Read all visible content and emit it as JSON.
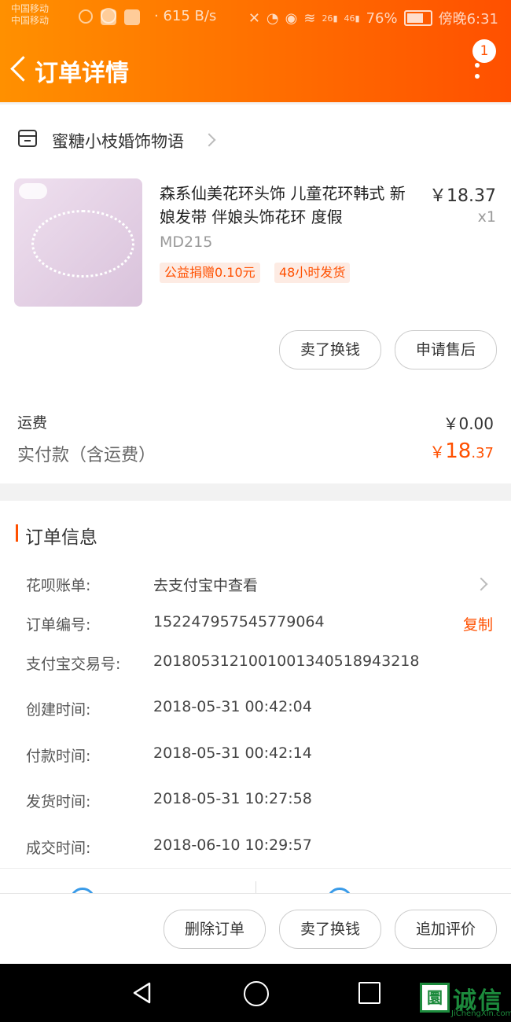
{
  "status_bar": {
    "carrier1": "中国移动",
    "carrier2": "中国移动",
    "net_speed": "· 615 B/s",
    "signal1": "26",
    "signal2": "46",
    "battery": "76%",
    "time": "傍晚6:31"
  },
  "header": {
    "title": "订单详情",
    "badge_count": "1"
  },
  "order_card": {
    "shop_name": "蜜糖小枝婚饰物语",
    "product": {
      "name": "森系仙美花环头饰 儿童花环韩式 新娘发带 伴娘头饰花环 度假",
      "sku": "MD215",
      "price": "￥18.37",
      "quantity": "x1",
      "tags": [
        "公益捐赠0.10元",
        "48小时发货"
      ]
    },
    "item_buttons": [
      "卖了换钱",
      "申请售后"
    ],
    "shipping_label": "运费",
    "shipping_value": "￥0.00",
    "paid_label": "实付款（含运费）",
    "paid_currency": "￥",
    "paid_integer": "18",
    "paid_decimal": ".37"
  },
  "order_info": {
    "title": "订单信息",
    "rows": [
      {
        "label": "花呗账单:",
        "value": "去支付宝中查看"
      },
      {
        "label": "订单编号:",
        "value": "152247957545779064",
        "action": "复制"
      },
      {
        "label": "支付宝交易号:",
        "value": "2018053121001001340518943218"
      },
      {
        "label": "创建时间:",
        "value": "2018-05-31 00:42:04"
      },
      {
        "label": "付款时间:",
        "value": "2018-05-31 00:42:14"
      },
      {
        "label": "发货时间:",
        "value": "2018-05-31 10:27:58"
      },
      {
        "label": "成交时间:",
        "value": "2018-06-10 10:29:57"
      }
    ]
  },
  "bottom_bar": {
    "buttons": [
      "删除订单",
      "卖了换钱",
      "追加评价"
    ]
  },
  "watermark": {
    "icon_char": "圜",
    "text": "诚信",
    "sub": "JiChengXin.com"
  },
  "colors": {
    "accent": "#ff5000",
    "header_gradient_start": "#ff9000",
    "header_gradient_end": "#ff5000"
  }
}
